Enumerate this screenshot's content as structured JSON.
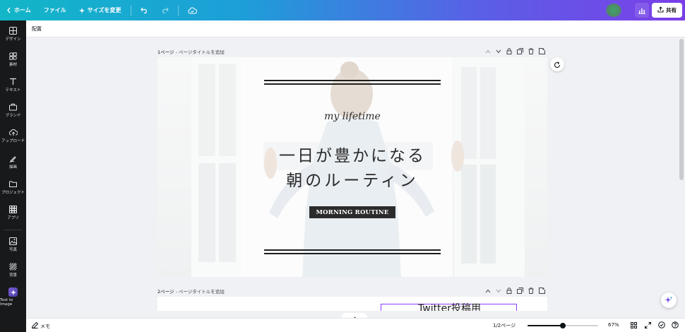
{
  "topbar": {
    "home_label": "ホーム",
    "file_label": "ファイル",
    "resize_label": "サイズを変更",
    "share_label": "共有"
  },
  "sidebar": {
    "items": [
      {
        "label": "デザイン",
        "icon": "layout-icon"
      },
      {
        "label": "素材",
        "icon": "shapes-icon"
      },
      {
        "label": "テキスト",
        "icon": "text-icon"
      },
      {
        "label": "ブランド",
        "icon": "briefcase-icon"
      },
      {
        "label": "アップロード",
        "icon": "cloud-upload-icon"
      },
      {
        "label": "描画",
        "icon": "pen-icon"
      },
      {
        "label": "プロジェクト",
        "icon": "folder-icon"
      },
      {
        "label": "アプリ",
        "icon": "grid-icon"
      },
      {
        "label": "写真",
        "icon": "image-icon"
      },
      {
        "label": "背景",
        "icon": "pattern-icon"
      },
      {
        "label": "Text to Image",
        "icon": "text-to-image-icon"
      }
    ]
  },
  "subbar": {
    "arrange_label": "配置"
  },
  "pages": [
    {
      "number": "1ページ",
      "title_placeholder": " - ページタイトルを追加"
    },
    {
      "number": "2ページ",
      "title_placeholder": " - ページタイトルを追加"
    }
  ],
  "design": {
    "script_text": "my lifetime",
    "heading_line1": "一日が豊かになる",
    "heading_line2": "朝のルーティン",
    "badge_text": "MORNING ROUTINE"
  },
  "page2": {
    "box_text": "Twitter投稿用"
  },
  "bottombar": {
    "notes_label": "メモ",
    "page_counter": "1/2ページ",
    "zoom_level": "67%",
    "zoom_fraction": 0.5
  },
  "colors": {
    "accent_purple": "#8b3dff",
    "sidebar_bg": "#18191b",
    "topbar_start": "#12b6c8",
    "topbar_end": "#7b3fe8"
  }
}
